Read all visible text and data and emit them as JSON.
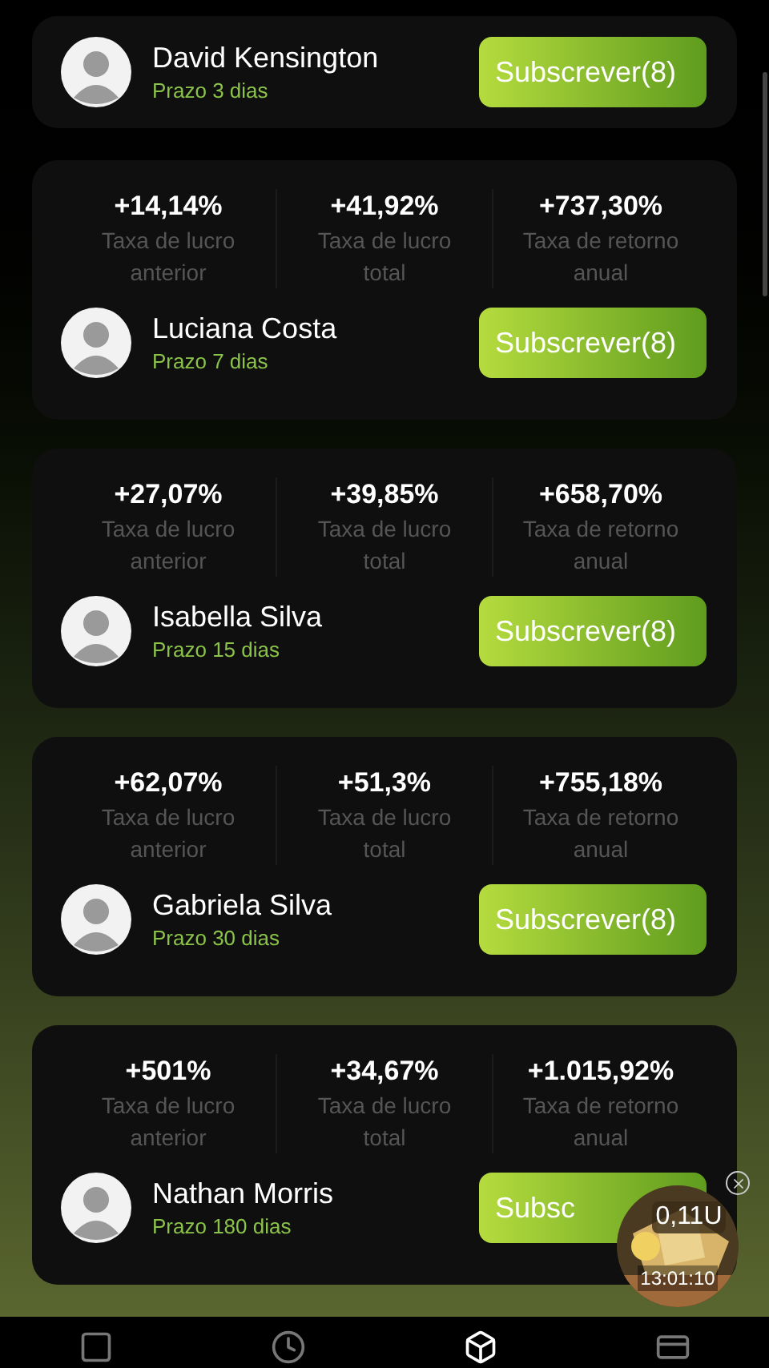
{
  "traders": [
    {
      "name": "David Kensington",
      "term": "Prazo 3 dias",
      "button": "Subscrever(8)"
    },
    {
      "stats": [
        {
          "value": "+14,14%",
          "label": "Taxa de lucro anterior"
        },
        {
          "value": "+41,92%",
          "label": "Taxa de lucro total"
        },
        {
          "value": "+737,30%",
          "label": "Taxa de retorno anual"
        }
      ],
      "name": "Luciana Costa",
      "term": "Prazo 7 dias",
      "button": "Subscrever(8)"
    },
    {
      "stats": [
        {
          "value": "+27,07%",
          "label": "Taxa de lucro anterior"
        },
        {
          "value": "+39,85%",
          "label": "Taxa de lucro total"
        },
        {
          "value": "+658,70%",
          "label": "Taxa de retorno anual"
        }
      ],
      "name": "Isabella Silva",
      "term": "Prazo 15 dias",
      "button": "Subscrever(8)"
    },
    {
      "stats": [
        {
          "value": "+62,07%",
          "label": "Taxa de lucro anterior"
        },
        {
          "value": "+51,3%",
          "label": "Taxa de lucro total"
        },
        {
          "value": "+755,18%",
          "label": "Taxa de retorno anual"
        }
      ],
      "name": "Gabriela Silva",
      "term": "Prazo 30 dias",
      "button": "Subscrever(8)"
    },
    {
      "stats": [
        {
          "value": "+501%",
          "label": "Taxa de lucro anterior"
        },
        {
          "value": "+34,67%",
          "label": "Taxa de lucro total"
        },
        {
          "value": "+1.015,92%",
          "label": "Taxa de retorno anual"
        }
      ],
      "name": "Nathan Morris",
      "term": "Prazo 180 dias",
      "button": "Subsc"
    }
  ],
  "floating_widget": {
    "amount": "0,11U",
    "timer": "13:01:10"
  },
  "nav": [
    {
      "kind": "screen",
      "selected": false
    },
    {
      "kind": "history",
      "selected": false
    },
    {
      "kind": "cube",
      "selected": true
    },
    {
      "kind": "wallet",
      "selected": false
    }
  ]
}
